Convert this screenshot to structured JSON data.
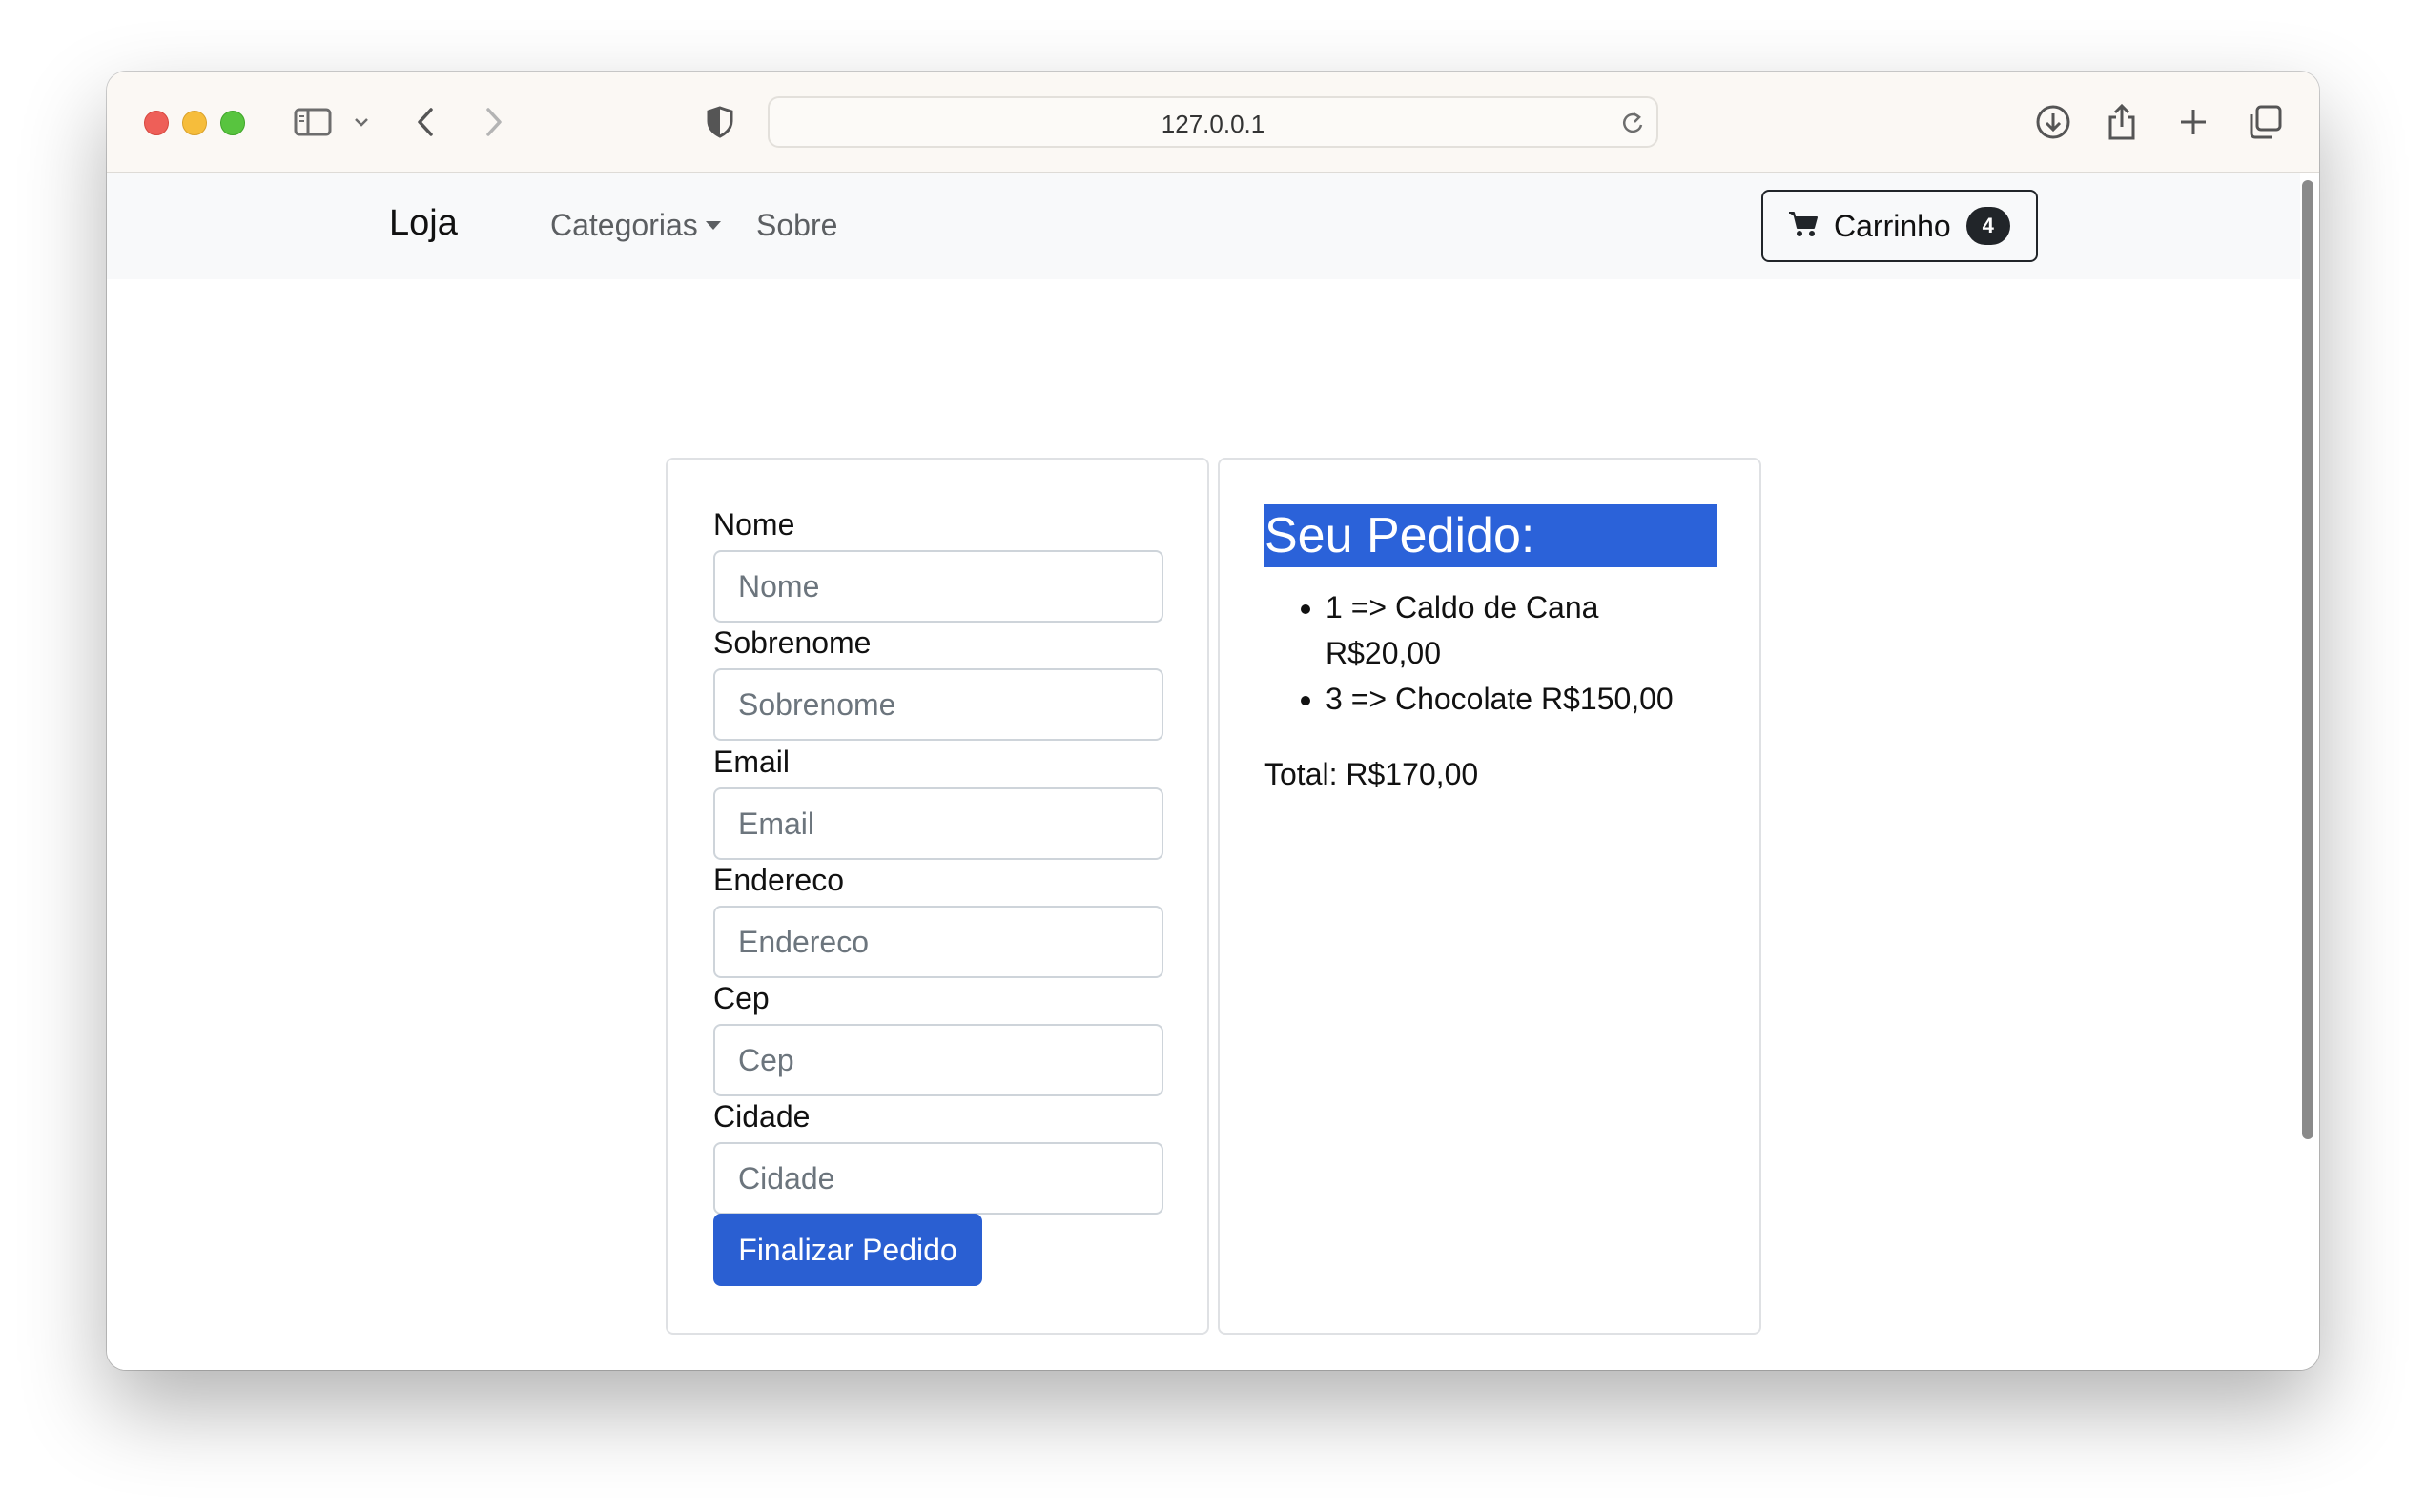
{
  "browser": {
    "url": "127.0.0.1",
    "toolbar_icons": [
      "sidebar-icon",
      "chevron-down-icon",
      "back-icon",
      "forward-icon",
      "shield-icon",
      "reload-icon",
      "download-icon",
      "share-icon",
      "new-tab-icon",
      "tab-overview-icon"
    ]
  },
  "navbar": {
    "brand": "Loja",
    "links": [
      {
        "label": "Categorias",
        "has_dropdown": true
      },
      {
        "label": "Sobre",
        "has_dropdown": false
      }
    ],
    "cart": {
      "label": "Carrinho",
      "count": "4",
      "icon": "cart-icon"
    }
  },
  "form": {
    "fields": [
      {
        "label": "Nome",
        "placeholder": "Nome"
      },
      {
        "label": "Sobrenome",
        "placeholder": "Sobrenome"
      },
      {
        "label": "Email",
        "placeholder": "Email"
      },
      {
        "label": "Endereco",
        "placeholder": "Endereco"
      },
      {
        "label": "Cep",
        "placeholder": "Cep"
      },
      {
        "label": "Cidade",
        "placeholder": "Cidade"
      }
    ],
    "submit_label": "Finalizar Pedido"
  },
  "order": {
    "title": "Seu Pedido:",
    "items": [
      "1 => Caldo de Cana R$20,00",
      "3 => Chocolate R$150,00"
    ],
    "total": "Total: R$170,00"
  },
  "colors": {
    "primary": "#2a5fd2",
    "selection_highlight": "#2b62d9",
    "navbar_bg": "#f8f9fa",
    "dark": "#212529"
  }
}
